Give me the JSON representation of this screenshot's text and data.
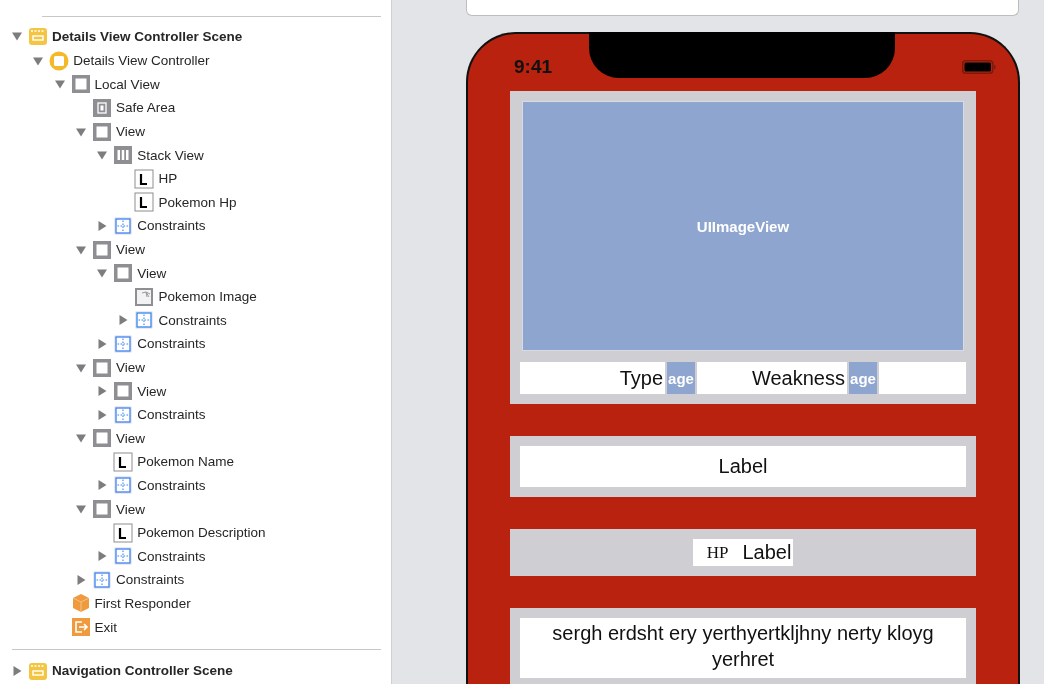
{
  "outline": [
    {
      "label": "Details View Controller Scene",
      "kind": "scene",
      "expanded": true,
      "children": [
        {
          "label": "Details View Controller",
          "kind": "controller",
          "expanded": true,
          "children": [
            {
              "label": "Local View",
              "kind": "view",
              "expanded": true,
              "children": [
                {
                  "label": "Safe Area",
                  "kind": "safe-area"
                },
                {
                  "label": "View",
                  "kind": "view",
                  "expanded": true,
                  "children": [
                    {
                      "label": "Stack View",
                      "kind": "stack",
                      "expanded": true,
                      "children": [
                        {
                          "label": "HP",
                          "kind": "label"
                        },
                        {
                          "label": "Pokemon Hp",
                          "kind": "label"
                        }
                      ]
                    },
                    {
                      "label": "Constraints",
                      "kind": "constraints",
                      "expanded": false
                    }
                  ]
                },
                {
                  "label": "View",
                  "kind": "view",
                  "expanded": true,
                  "children": [
                    {
                      "label": "View",
                      "kind": "view",
                      "expanded": true,
                      "children": [
                        {
                          "label": "Pokemon Image",
                          "kind": "image"
                        },
                        {
                          "label": "Constraints",
                          "kind": "constraints",
                          "expanded": false
                        }
                      ]
                    },
                    {
                      "label": "Constraints",
                      "kind": "constraints",
                      "expanded": false
                    }
                  ]
                },
                {
                  "label": "View",
                  "kind": "view",
                  "expanded": true,
                  "children": [
                    {
                      "label": "View",
                      "kind": "view",
                      "expanded": false
                    },
                    {
                      "label": "Constraints",
                      "kind": "constraints",
                      "expanded": false
                    }
                  ]
                },
                {
                  "label": "View",
                  "kind": "view",
                  "expanded": true,
                  "children": [
                    {
                      "label": "Pokemon Name",
                      "kind": "label"
                    },
                    {
                      "label": "Constraints",
                      "kind": "constraints",
                      "expanded": false
                    }
                  ]
                },
                {
                  "label": "View",
                  "kind": "view",
                  "expanded": true,
                  "children": [
                    {
                      "label": "Pokemon Description",
                      "kind": "label"
                    },
                    {
                      "label": "Constraints",
                      "kind": "constraints",
                      "expanded": false
                    }
                  ]
                },
                {
                  "label": "Constraints",
                  "kind": "constraints",
                  "expanded": false
                }
              ]
            },
            {
              "label": "First Responder",
              "kind": "responder"
            },
            {
              "label": "Exit",
              "kind": "exit"
            }
          ]
        }
      ]
    },
    {
      "label": "Navigation Controller Scene",
      "kind": "scene",
      "expanded": false
    }
  ],
  "device": {
    "time": "9:41",
    "image_placeholder": "UIImageView",
    "type_row": [
      {
        "kind": "label",
        "text": "Type"
      },
      {
        "kind": "image",
        "text": "age"
      },
      {
        "kind": "label",
        "text": "Weakness"
      },
      {
        "kind": "image",
        "text": "age"
      },
      {
        "kind": "spacer"
      }
    ],
    "name_label": "Label",
    "hp_title": "HP",
    "hp_label": "Label",
    "description": "sergh erdsht ery yerthyertkljhny nerty kloyg  yerhret"
  }
}
